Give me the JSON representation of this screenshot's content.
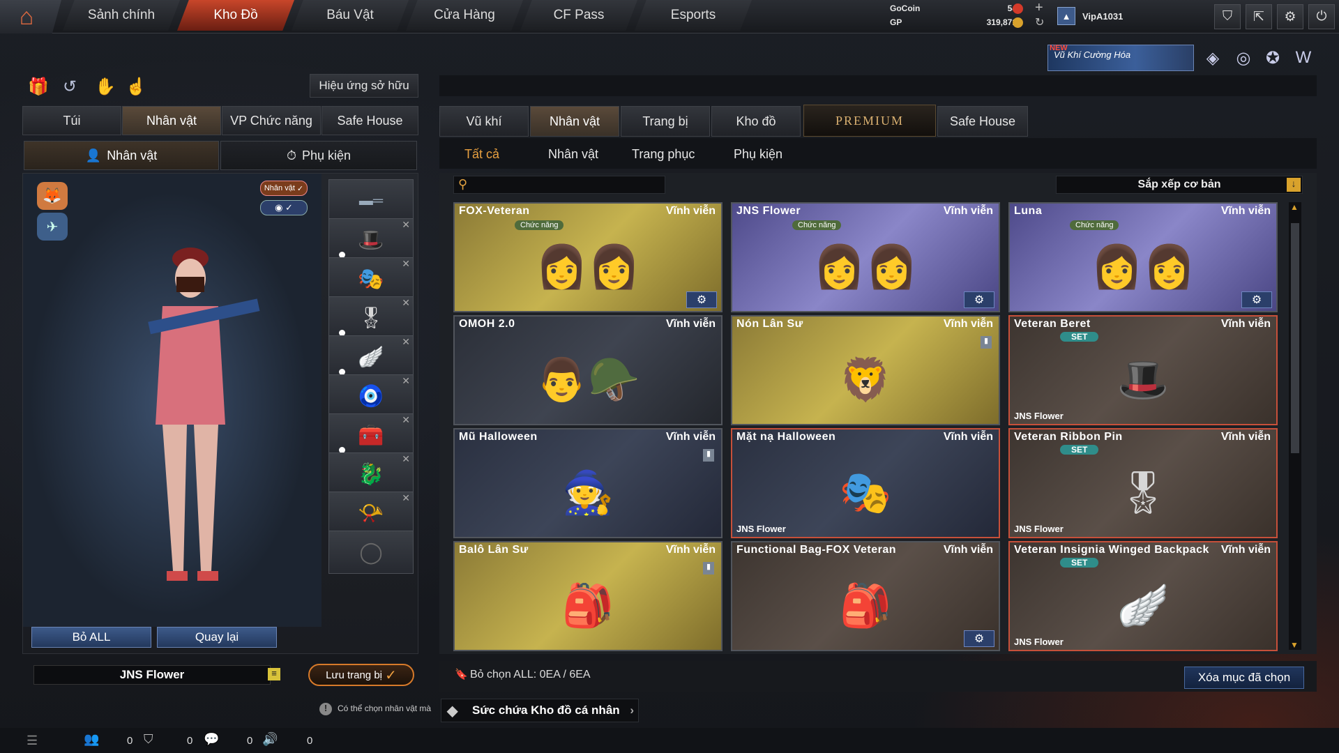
{
  "top_nav": {
    "tabs": [
      "Sảnh chính",
      "Kho Đồ",
      "Báu Vật",
      "Cửa Hàng",
      "CF Pass",
      "Esports"
    ],
    "active": "Kho Đồ"
  },
  "resources": {
    "gocoin_label": "GoCoin",
    "gocoin_value": "54",
    "gp_label": "GP",
    "gp_value": "319,871",
    "username": "VipA1031"
  },
  "banner": {
    "new_label": "NEW",
    "text": "Vũ Khí Cường Hóa"
  },
  "effects_button": "Hiệu ứng sở hữu",
  "left_tabs": [
    "Túi",
    "Nhân vật",
    "VP Chức năng",
    "Safe House"
  ],
  "left_subtabs": [
    "Nhân vật",
    "Phụ kiện"
  ],
  "char_toggle": "Nhân vật",
  "bottom_buttons": {
    "remove_all": "Bỏ ALL",
    "back": "Quay lại"
  },
  "preset_name": "JNS Flower",
  "save_button": "Lưu trang bị",
  "hint": "Có thể chọn nhân vật mà",
  "storage_capacity": "Sức chứa Kho đồ cá nhân",
  "status_counts": [
    "0",
    "0",
    "0",
    "0"
  ],
  "right_tabs": [
    "Vũ khí",
    "Nhân vật",
    "Trang bị",
    "Kho đồ",
    "PREMIUM",
    "Safe House"
  ],
  "right_subtabs": [
    "Tất cả",
    "Nhân vật",
    "Trang phục",
    "Phụ kiện"
  ],
  "sort_label": "Sắp xếp cơ bản",
  "deselect_label": "Bỏ chọn ALL: 0EA / 6EA",
  "delete_selected": "Xóa mục đã chọn",
  "items": [
    {
      "name": "FOX-Veteran",
      "period": "Vĩnh viễn",
      "tag": "Chức năng",
      "owner": "",
      "set": "",
      "style": "gold",
      "art": "👩👩"
    },
    {
      "name": "JNS Flower",
      "period": "Vĩnh viễn",
      "tag": "Chức năng",
      "owner": "",
      "set": "",
      "style": "purple",
      "art": "👩👩"
    },
    {
      "name": "Luna",
      "period": "Vĩnh viễn",
      "tag": "Chức năng",
      "owner": "",
      "set": "",
      "style": "purple",
      "art": "👩👩"
    },
    {
      "name": "OMOH 2.0",
      "period": "Vĩnh viễn",
      "tag": "",
      "owner": "",
      "set": "",
      "style": "dark",
      "art": "👨🪖"
    },
    {
      "name": "Nón Lân Sư",
      "period": "Vĩnh viễn",
      "tag": "",
      "owner": "",
      "set": "",
      "style": "gold",
      "art": "🦁"
    },
    {
      "name": "Veteran Beret",
      "period": "Vĩnh viễn",
      "tag": "",
      "owner": "JNS Flower",
      "set": "SET",
      "style": "brown",
      "art": "🎩"
    },
    {
      "name": "Mũ Halloween",
      "period": "Vĩnh viễn",
      "tag": "",
      "owner": "",
      "set": "",
      "style": "navy",
      "art": "🧙"
    },
    {
      "name": "Mặt nạ Halloween",
      "period": "Vĩnh viễn",
      "tag": "",
      "owner": "JNS Flower",
      "set": "",
      "style": "navy",
      "art": "🎭"
    },
    {
      "name": "Veteran Ribbon Pin",
      "period": "Vĩnh viễn",
      "tag": "",
      "owner": "JNS Flower",
      "set": "SET",
      "style": "brown",
      "art": "🎖"
    },
    {
      "name": "Balô Lân Sư",
      "period": "Vĩnh viễn",
      "tag": "",
      "owner": "",
      "set": "",
      "style": "gold",
      "art": "🎒"
    },
    {
      "name": "Functional Bag-FOX Veteran",
      "period": "Vĩnh viễn",
      "tag": "",
      "owner": "",
      "set": "",
      "style": "brown",
      "art": "🎒"
    },
    {
      "name": "Veteran Insignia Winged Backpack",
      "period": "Vĩnh viễn",
      "tag": "",
      "owner": "JNS Flower",
      "set": "SET",
      "style": "brown",
      "art": "🪽"
    }
  ]
}
